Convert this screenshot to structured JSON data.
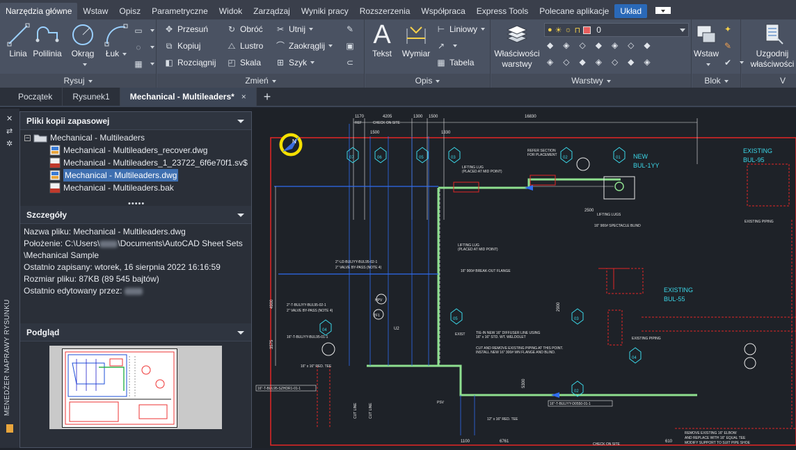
{
  "ribbon_tabs": [
    "Narzędzia główne",
    "Wstaw",
    "Opisz",
    "Parametryczne",
    "Widok",
    "Zarządzaj",
    "Wyniki pracy",
    "Rozszerzenia",
    "Współpraca",
    "Express Tools",
    "Polecane aplikacje",
    "Układ"
  ],
  "draw": {
    "linia": "Linia",
    "polilinia": "Polilinia",
    "okrag": "Okrąg",
    "luk": "Łuk",
    "label": "Rysuj"
  },
  "modify": {
    "przesun": "Przesuń",
    "obroc": "Obróć",
    "utnij": "Utnij",
    "kopiuj": "Kopiuj",
    "lustro": "Lustro",
    "zaokraglij": "Zaokrąglij",
    "rozciagnij": "Rozciągnij",
    "skala": "Skala",
    "szyk": "Szyk",
    "label": "Zmień"
  },
  "annotation": {
    "tekst": "Tekst",
    "wymiar": "Wymiar",
    "liniowy": "Liniowy",
    "tabela": "Tabela",
    "label": "Opis"
  },
  "layers": {
    "wlasciwosci": "Właściwości",
    "warstwy": "warstwy",
    "current_layer": "0",
    "layer_color": "#e85d5d",
    "label": "Warstwy"
  },
  "block": {
    "wstaw": "Wstaw",
    "label": "Blok"
  },
  "props": {
    "uzgodnij": "Uzgodnij",
    "wlasciwosci": "właściwości"
  },
  "doc_tabs": {
    "start": "Początek",
    "rysunek": "Rysunek1",
    "active": "Mechanical - Multileaders*",
    "close": "×",
    "plus": "+"
  },
  "manager": {
    "vertical_title": "MENEDŻER NAPRAWY RYSUNKU",
    "backup_header": "Pliki kopii zapasowej",
    "root": "Mechanical - Multileaders",
    "files": [
      {
        "name": "Mechanical - Multileaders_recover.dwg",
        "type": "dwg"
      },
      {
        "name": "Mechanical - Multileaders_1_23722_6f6e70f1.sv$",
        "type": "sv"
      },
      {
        "name": "Mechanical - Multileaders.dwg",
        "type": "dwg"
      },
      {
        "name": "Mechanical - Multileaders.bak",
        "type": "bak"
      }
    ],
    "dots": "•••••",
    "details_header": "Szczegóły",
    "details": {
      "name": "Nazwa pliku: Mechanical - Multileaders.dwg",
      "loc1_a": "Położenie: C:\\Users\\",
      "loc1_b": "\\Documents\\AutoCAD Sheet Sets",
      "loc2": "\\Mechanical Sample",
      "saved": "Ostatnio zapisany: wtorek, 16 sierpnia 2022   16:16:59",
      "size": "Rozmiar pliku: 87KB (89 545 bajtów)",
      "edited": "Ostatnio edytowany przez:"
    },
    "preview_header": "Podgląd"
  },
  "drawing": {
    "dims": [
      "1170",
      "4205",
      "1300",
      "1500",
      "16830",
      "1500",
      "1330",
      "4900",
      "2900",
      "3575",
      "5300",
      "2500",
      "6761",
      "1100",
      "610"
    ],
    "texts": {
      "ref": "REF",
      "check1": "CHECK ON SITE",
      "check2": "CHECK ON SITE",
      "new_label": "NEW",
      "new_bul": "BUL-1YY",
      "exist1": "EXISTING",
      "exist1b": "BUL-95",
      "exist2": "EXISTING",
      "exist2b": "BUL-55",
      "lifting_lug": "LIFTING LUG",
      "lifting_lug2": "(PLACED AT MID POINT)",
      "refer": "REFER SECTION",
      "refer2": "FOR PLACEMENT",
      "lifting_lugs": "LIFTING LUGS",
      "blind": "16\" 900# SPECTACLE BLIND",
      "lifting_lug3": "LIFTING LUG",
      "lifting_lug4": "(PLACED AT MID POINT)",
      "breakout": "16\" 900# BREAK-OUT FLANGE",
      "valve1": "2\"-U2-BULIYY-BUL95-02-1",
      "valve1b": "2\" VALVE BY-PASS (NOTE 4)",
      "valve2": "2\"-T-BULIYY-BUL95-02-1",
      "valve2b": "2\" VALVE BY-PASS (NOTE 4)",
      "valve3": "16\"-T-BULIYY-BUL95-01-1",
      "tiein": "TIE-IN NEW 16\" DIFFUSER LINE USING",
      "tiein2": "16\" x 16\" STD. WT. WELDOLET",
      "cut": "CUT AND REMOVE EXISTING PIPING AT THIS POINT.",
      "cut2": "INSTALL NEW 16\" 300# WN FLANGE AND BLIND.",
      "existing_piping": "EXISTING PIPING",
      "existing_piping2": "EXISTING PIPING",
      "red_tee": "16\" x 16\" RED. TEE",
      "red_tee2": "12\" x 16\" RED. TEE",
      "remove1": "REMOVE EXISTING 16\" ELBOW",
      "remove2": "AND REPLACE WITH 16\" EQUAL TEE",
      "remove3": "MODIFY SUPPORT TO SUIT PIPE SHOE",
      "hpv": "HPV",
      "tf1": "TF1",
      "u2": "U2",
      "psv": "PSV",
      "cutline1": "CUT LINE",
      "cutline2": "CUT LINE",
      "line_bot": "16\"-T-BULIYY-D0550-01-1",
      "line_left": "16\"-T-BUL95-SZHDR1-01-1",
      "exist3": "EXIST"
    },
    "tags": [
      "07",
      "06",
      "05",
      "03",
      "02",
      "01",
      "04",
      "05",
      "03",
      "04",
      "02",
      "03",
      "01"
    ]
  }
}
